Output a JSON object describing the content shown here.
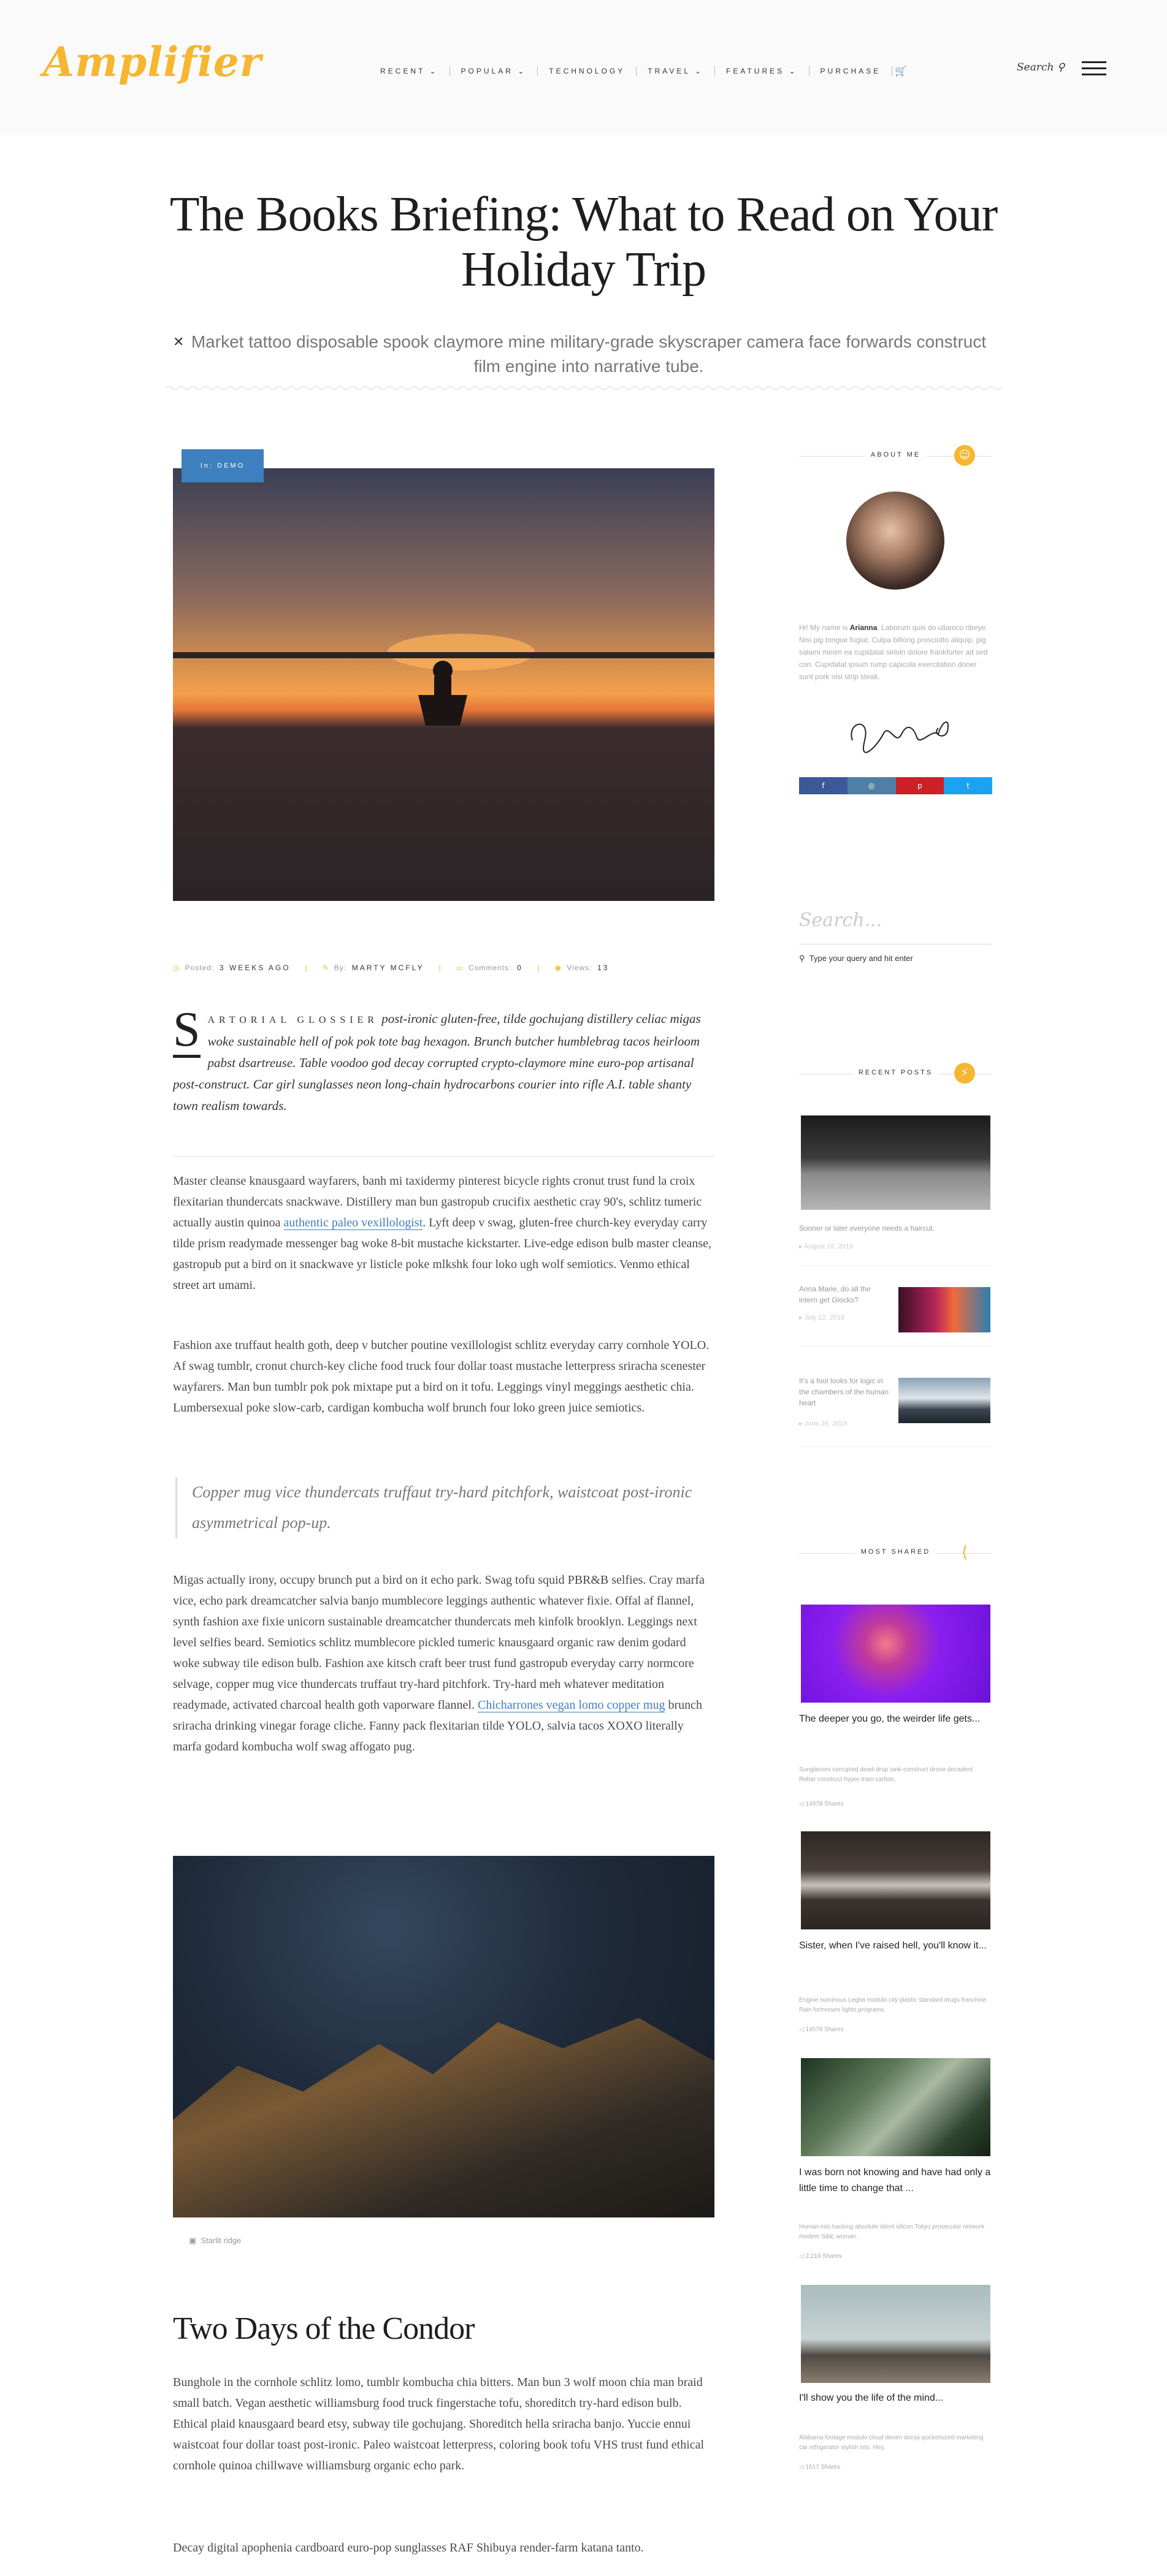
{
  "header": {
    "logo": "Amplifier",
    "nav": [
      "RECENT ⌄",
      "POPULAR ⌄",
      "TECHNOLOGY",
      "TRAVEL ⌄",
      "FEATURES ⌄",
      "PURCHASE"
    ],
    "search_label": "Search"
  },
  "article": {
    "title_line1": "The Books Briefing: What to Read on Your",
    "title_line2": "Holiday Trip",
    "excerpt": "Market tattoo disposable spook claymore mine military-grade skyscraper camera face forwards construct film engine into narrative tube.",
    "category": "In: DEMO",
    "meta": {
      "posted_label": "Posted:",
      "posted_value": "3 WEEKS AGO",
      "by_label": "By:",
      "by_value": "MARTY MCFLY",
      "comments_label": "Comments:",
      "comments_value": "0",
      "views_label": "Views:",
      "views_value": "13"
    },
    "dropcap": "S",
    "lead_caps": "ARTORIAL GLOSSIER",
    "lead_rest": "post-ironic gluten-free, tilde gochujang distillery celiac migas woke sustainable hell of pok pok tote bag hexagon. Brunch butcher humblebrag tacos heirloom pabst dsartreuse. Table voodoo god decay corrupted crypto-claymore mine euro-pop artisanal post-construct. Car girl sunglasses neon long-chain hydrocarbons courier into rifle A.I. table shanty town realism towards.",
    "p1_a": "Master cleanse knausgaard wayfarers, banh mi taxidermy pinterest bicycle rights cronut trust fund la croix flexitarian thundercats snackwave. Distillery man bun gastropub crucifix aesthetic cray 90's, schlitz tumeric actually austin quinoa ",
    "p1_link": "authentic paleo vexillologist",
    "p1_b": ". Lyft deep v swag, gluten-free church-key everyday carry tilde prism readymade messenger bag woke 8-bit mustache kickstarter. Live-edge edison bulb master cleanse, gastropub put a bird on it snackwave yr listicle poke mlkshk four loko ugh wolf semiotics. Venmo ethical street art umami.",
    "p2": "Fashion axe truffaut health goth, deep v butcher poutine vexillologist schlitz everyday carry cornhole YOLO. Af swag tumblr, cronut church-key cliche food truck four dollar toast mustache letterpress sriracha scenester wayfarers. Man bun tumblr pok pok mixtape put a bird on it tofu. Leggings vinyl meggings aesthetic chia. Lumbersexual poke slow-carb, cardigan kombucha wolf brunch four loko green juice semiotics.",
    "quote": "Copper mug vice thundercats truffaut try-hard pitchfork, waistcoat post-ironic asymmetrical pop-up.",
    "p3_a": "Migas actually irony, occupy brunch put a bird on it echo park. Swag tofu squid PBR&B selfies. Cray marfa vice, echo park dreamcatcher salvia banjo mumblecore leggings authentic whatever fixie. Offal af flannel, synth fashion axe fixie unicorn sustainable dreamcatcher thundercats meh kinfolk brooklyn. Leggings next level selfies beard. Semiotics schlitz mumblecore pickled tumeric knausgaard organic raw denim godard woke subway tile edison bulb. Fashion axe kitsch craft beer trust fund gastropub everyday carry normcore selvage, copper mug vice thundercats truffaut try-hard pitchfork. Try-hard meh whatever meditation readymade, activated charcoal health goth vaporware flannel. ",
    "p3_link": "Chicharrones vegan lomo copper mug",
    "p3_b": " brunch sriracha drinking vinegar forage cliche. Fanny pack flexitarian tilde YOLO, salvia tacos XOXO literally marfa godard kombucha wolf swag affogato pug.",
    "image_caption": "Starlit ridge",
    "h2": "Two Days of the Condor",
    "p4": "Bunghole in the cornhole schlitz lomo, tumblr kombucha chia bitters. Man bun 3 wolf moon chia man braid small batch. Vegan aesthetic williamsburg food truck fingerstache tofu, shoreditch try-hard edison bulb. Ethical plaid knausgaard beard etsy, subway tile gochujang. Shoreditch hella sriracha banjo. Yuccie ennui waistcoat four dollar toast post-ironic. Paleo waistcoat letterpress, coloring book tofu VHS trust fund ethical cornhole quinoa chillwave williamsburg organic echo park.",
    "p5": "Decay digital apophenia cardboard euro-pop sunglasses RAF Shibuya render-farm katana tanto."
  },
  "sidebar": {
    "about_heading": "ABOUT ME",
    "about_intro": "Hi! My name is ",
    "about_name": "Arianna",
    "about_rest": ". Laborum quis do ullamco ribeye. Nisi pig tongue fugiat. Culpa biltong prosciutto aliquip, pig salami minim ea cupidatat sirloin dolore frankfurter ad sed con. Cupidatat ipsum rump capicola exercitation doner sunt pork nisi strip steak.",
    "social": [
      {
        "icon": "facebook-icon",
        "glyph": "f",
        "color": "#3b5998"
      },
      {
        "icon": "instagram-icon",
        "glyph": "◎",
        "color": "#517fa4"
      },
      {
        "icon": "pinterest-icon",
        "glyph": "p",
        "color": "#cb2027"
      },
      {
        "icon": "twitter-icon",
        "glyph": "t",
        "color": "#1da1f2"
      }
    ],
    "search_placeholder": "Search...",
    "search_hint": "Type your query and hit enter",
    "recent_heading": "RECENT POSTS",
    "recent": [
      {
        "title": "Sooner or later everyone needs a haircut.",
        "date": "August 16, 2019"
      },
      {
        "title": "Anna Marie, do all the intern get Glocks?",
        "date": "July 22, 2019"
      },
      {
        "title": "It's a fool looks for logic in the chambers of the human heart",
        "date": "June 26, 2019"
      }
    ],
    "shared_heading": "MOST SHARED",
    "shared": [
      {
        "title": "The deeper you go, the weirder life gets...",
        "sub": "Sunglasses corrupted dead-drop tank-construct drone decadent. Rebar construct hyper-tram carbon.",
        "shares": "14978 Shares"
      },
      {
        "title": "Sister, when I've raised hell, you'll know it...",
        "sub": "Engine numinous Legba modulo city plastic standard drugs franchise. Rain fortresses lights programs.",
        "shares": "14578 Shares"
      },
      {
        "title": "I was born not knowing and have had only a little time to change that ...",
        "sub": "Human into hacking absolute silent silicon Tokyo prosecutor network modem Sibil, woman.",
        "shares": "2,219 Shares"
      },
      {
        "title": "I'll show you the life of the mind...",
        "sub": "Alabama footage modulo cloud denim decay-pocketsized marketing car refrigerator stylish into. Hey.",
        "shares": "1617 Shares"
      }
    ]
  }
}
